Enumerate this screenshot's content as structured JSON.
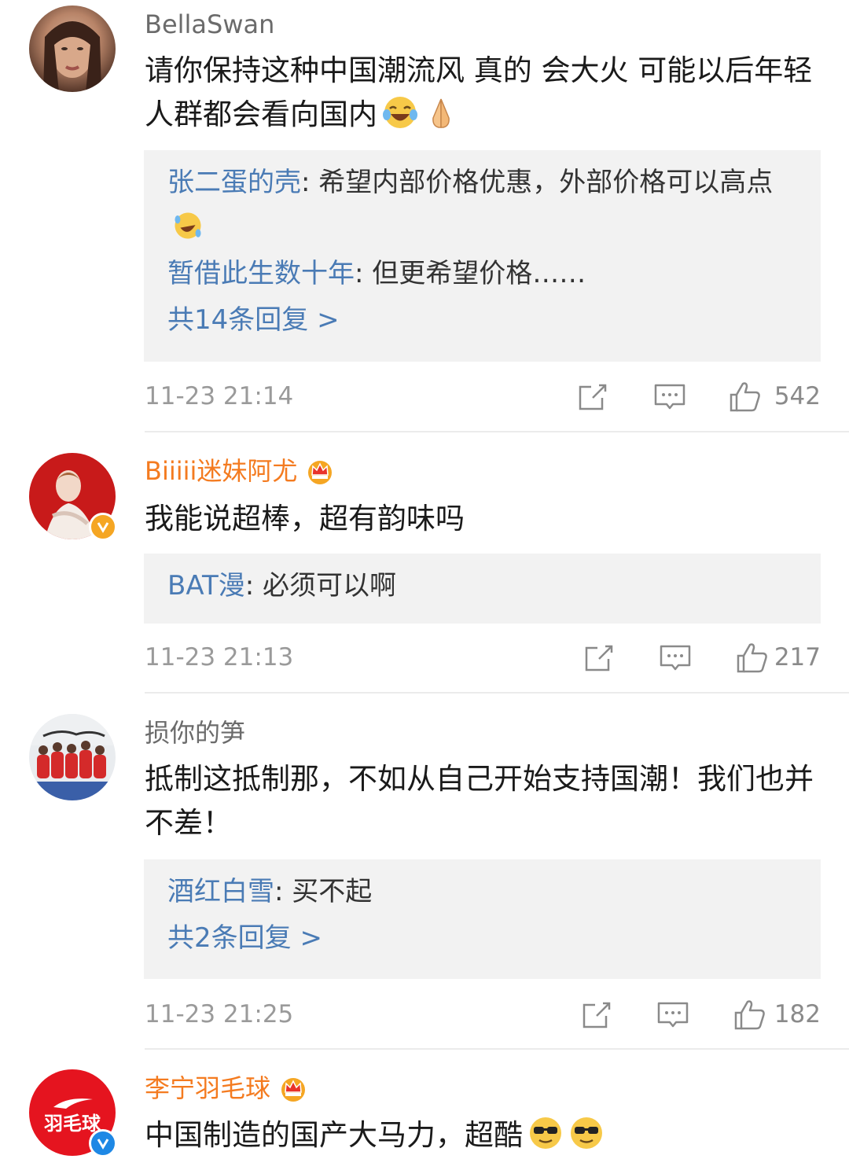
{
  "comments": [
    {
      "username": "BellaSwan",
      "text": "请你保持这种中国潮流风 真的 会大火 可能以后年轻人群都会看向国内",
      "replies": [
        {
          "user": "张二蛋的壳",
          "text": ": 希望内部价格优惠，外部价格可以高点"
        },
        {
          "user": "暂借此生数十年",
          "text": ": 但更希望价格……"
        }
      ],
      "more_replies": "共14条回复 >",
      "time": "11-23 21:14",
      "likes": "542"
    },
    {
      "username": "Biiiii迷妹阿尤",
      "text": "我能说超棒，超有韵味吗",
      "replies": [
        {
          "user": "BAT漫",
          "text": ": 必须可以啊"
        }
      ],
      "time": "11-23 21:13",
      "likes": "217"
    },
    {
      "username": "损你的笋",
      "text": "抵制这抵制那，不如从自己开始支持国潮！我们也并不差！",
      "replies": [
        {
          "user": "酒红白雪",
          "text": ": 买不起"
        }
      ],
      "more_replies": "共2条回复 >",
      "time": "11-23 21:25",
      "likes": "182"
    },
    {
      "username": "李宁羽毛球",
      "text": "中国制造的国产大马力，超酷",
      "avatar_text": "羽毛球"
    }
  ],
  "colors": {
    "link_blue": "#4a7bb5",
    "vip_orange": "#f47b20",
    "reply_bg": "#f2f2f2",
    "verified_gold": "#f5a623",
    "verified_blue": "#1e88e5"
  }
}
